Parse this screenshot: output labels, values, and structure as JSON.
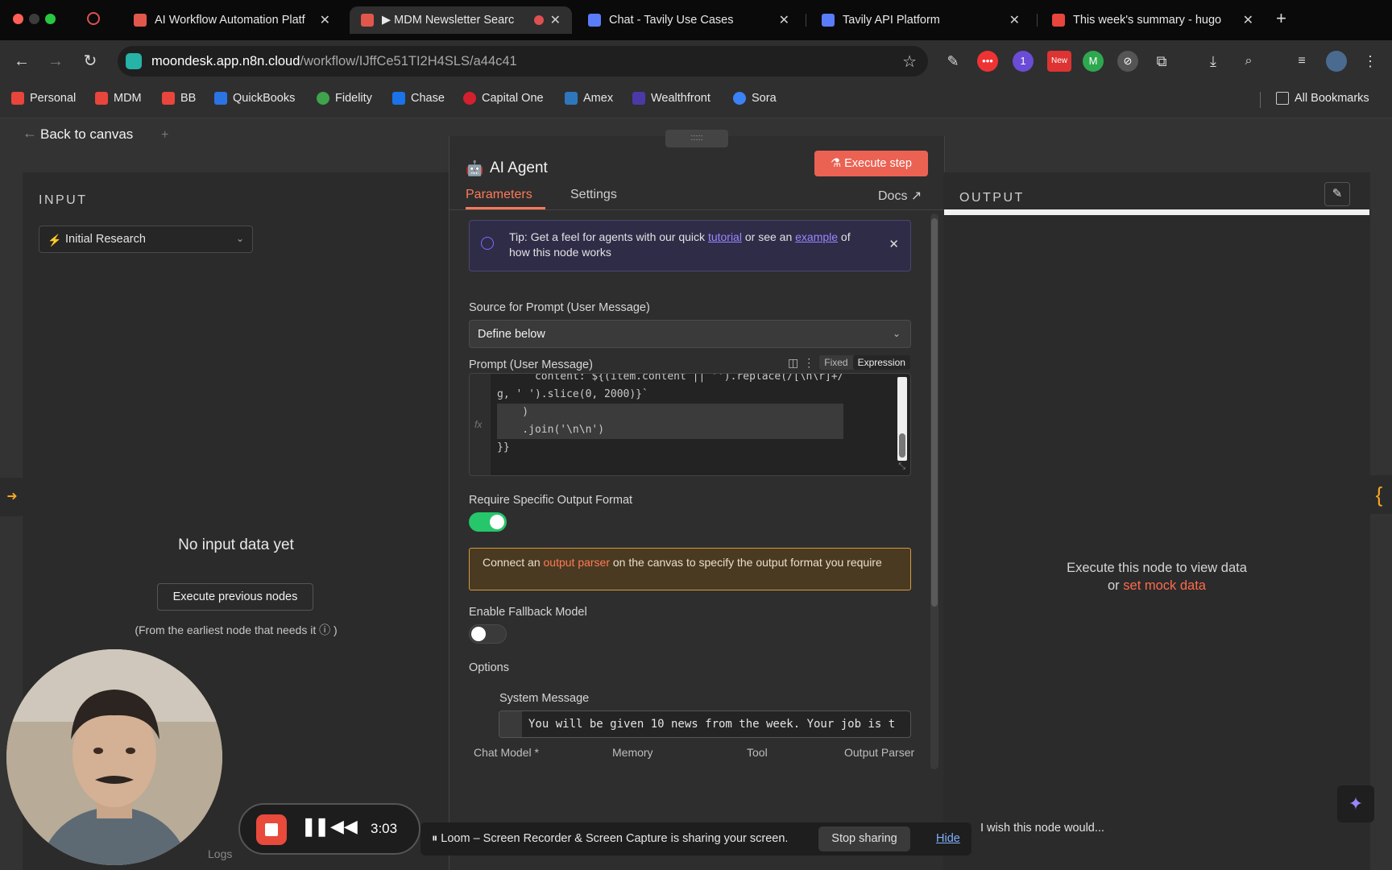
{
  "browser": {
    "tabs": [
      {
        "title": "AI Workflow Automation Platf",
        "active": false
      },
      {
        "title": "▶ MDM Newsletter Searc",
        "active": true
      },
      {
        "title": "Chat - Tavily Use Cases",
        "active": false
      },
      {
        "title": "Tavily API Platform",
        "active": false
      },
      {
        "title": "This week's summary - hugo",
        "active": false
      }
    ],
    "new_tab": "+",
    "url_host": "moondesk.app.n8n.cloud",
    "url_path": "/workflow/IJffCe51TI2H4SLS/a44c41",
    "extension_badges": {
      "new": "New",
      "count": "1"
    },
    "bookmarks": [
      "Personal",
      "MDM",
      "BB",
      "QuickBooks",
      "Fidelity",
      "Chase",
      "Capital One",
      "Amex",
      "Wealthfront",
      "Sora"
    ],
    "all_bookmarks": "All Bookmarks"
  },
  "app": {
    "back_label": "Back to canvas",
    "input": {
      "title": "INPUT",
      "selected_node": "Initial Research",
      "empty_title": "No input data yet",
      "execute_previous": "Execute previous nodes",
      "hint": "(From the earliest node that needs it ⓘ )"
    },
    "ndv": {
      "node_name": "AI Agent",
      "execute_step": "Execute step",
      "tabs": {
        "parameters": "Parameters",
        "settings": "Settings",
        "docs": "Docs"
      },
      "tip": {
        "prefix": "Tip: Get a feel for agents with our quick ",
        "link1": "tutorial",
        "middle": " or see an ",
        "link2": "example",
        "suffix": " of how this node works"
      },
      "source_label": "Source for Prompt (User Message)",
      "source_value": "Define below",
      "prompt_label": "Prompt (User Message)",
      "mode_fixed": "Fixed",
      "mode_expression": "Expression",
      "code_lines": [
        "      content: ${(item.content || '').replace(/[\\n\\r]+/",
        "g, ' ').slice(0, 2000)}`",
        "    )",
        "    .join('\\n\\n')",
        "}}"
      ],
      "require_format_label": "Require Specific Output Format",
      "require_format_on": true,
      "warning": {
        "prefix": "Connect an ",
        "link": "output parser",
        "suffix": " on the canvas to specify the output format you require"
      },
      "fallback_label": "Enable Fallback Model",
      "fallback_on": false,
      "options_label": "Options",
      "system_message_label": "System Message",
      "system_message_value": "You will be given 10 news from the week. Your job is t",
      "sub_nodes": [
        "Chat Model *",
        "Memory",
        "Tool",
        "Output Parser"
      ]
    },
    "output": {
      "title": "OUTPUT",
      "empty_line1": "Execute this node to view data",
      "empty_prefix": "or ",
      "mock_link": "set mock data"
    },
    "feedback_placeholder": "I wish this node would...",
    "logs": "Logs"
  },
  "loom": {
    "timer": "3:03",
    "sharing_text": "⏸ Loom – Screen Recorder & Screen Capture is sharing your screen.",
    "stop_sharing": "Stop sharing",
    "hide": "Hide"
  },
  "colors": {
    "accent": "#ff7a59",
    "execute_button": "#eb6253",
    "toggle_on": "#26c66b",
    "tip_link": "#9b86ff"
  }
}
